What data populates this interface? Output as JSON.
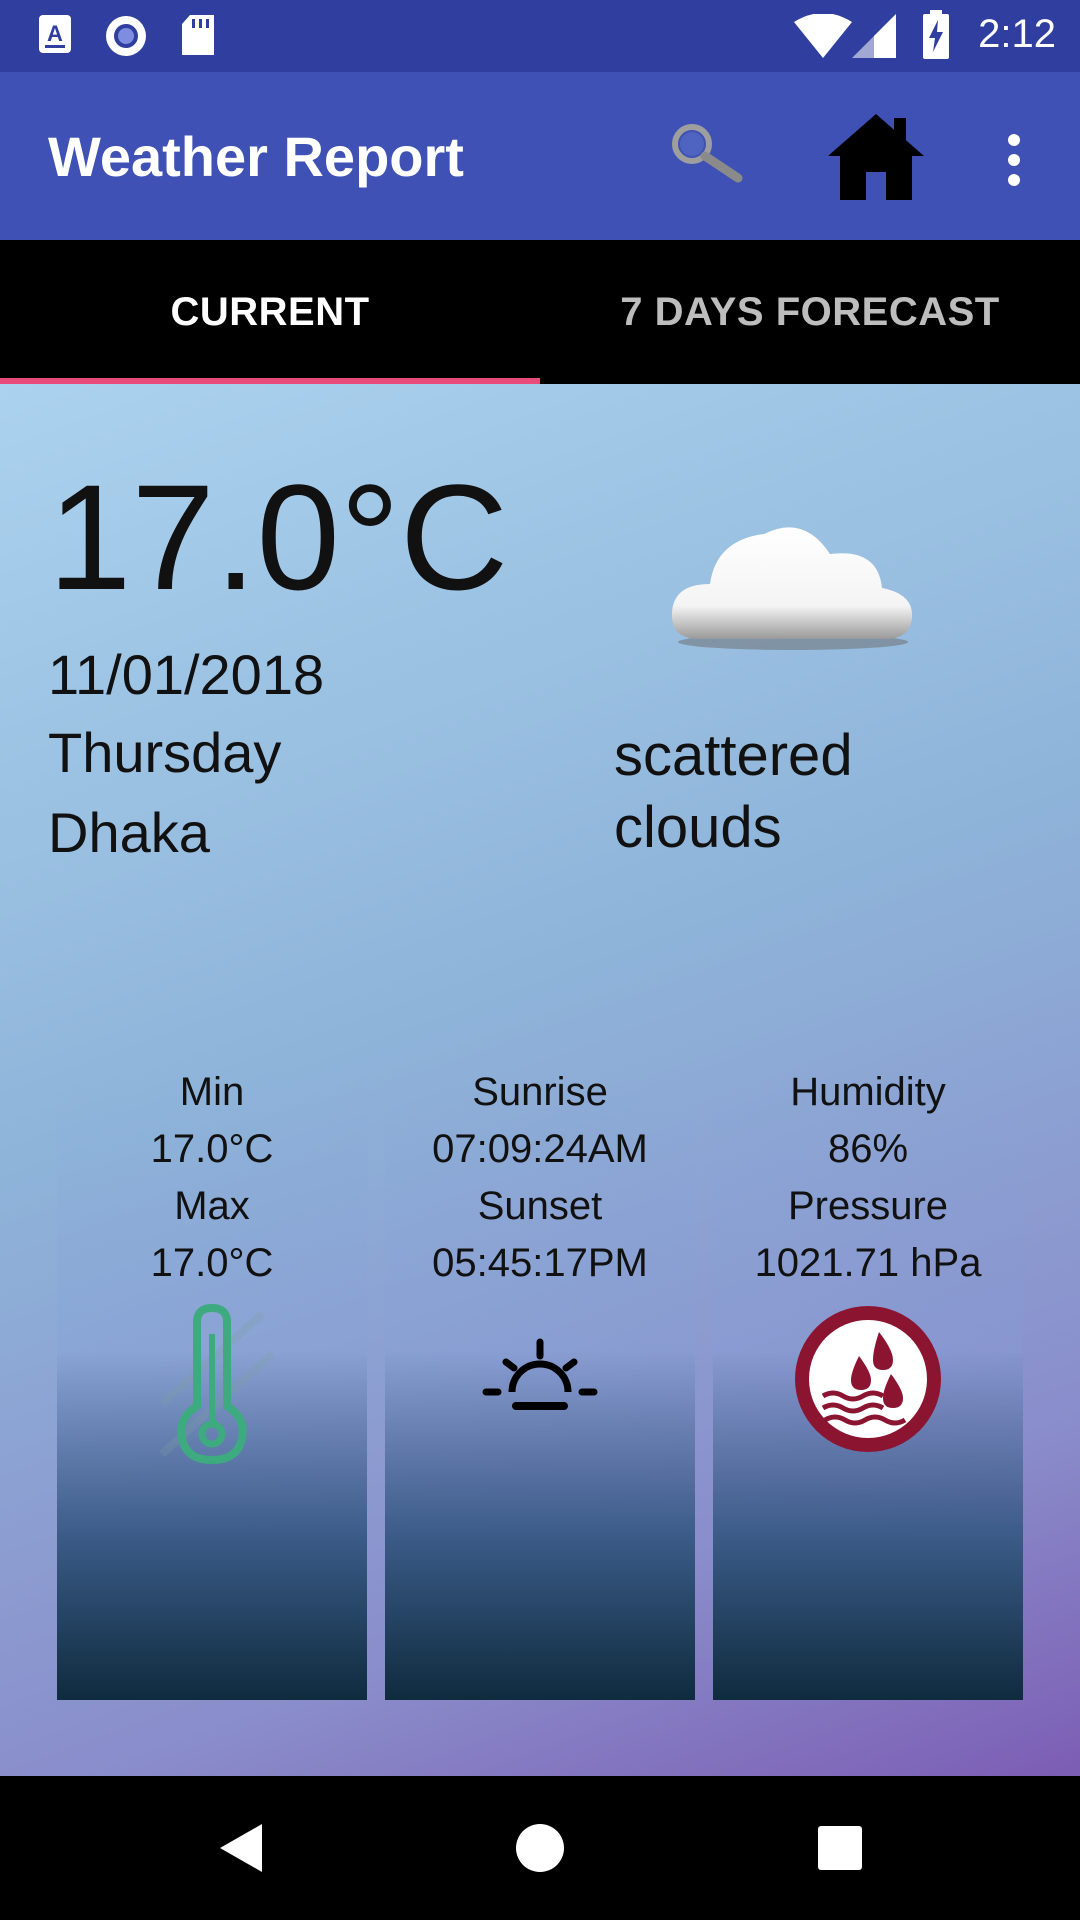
{
  "status_bar": {
    "time": "2:12",
    "icons": [
      "a-text-icon",
      "record-icon",
      "sd-card-icon",
      "wifi-icon",
      "cell-signal-icon",
      "battery-charging-icon"
    ]
  },
  "app_bar": {
    "title": "Weather Report",
    "actions": [
      "search-icon",
      "home-icon",
      "more-vert-icon"
    ]
  },
  "tabs": [
    {
      "label": "CURRENT",
      "active": true
    },
    {
      "label": "7 DAYS FORECAST",
      "active": false
    }
  ],
  "current": {
    "temperature": "17.0°C",
    "date": "11/01/2018",
    "day": "Thursday",
    "city": "Dhaka",
    "description": "scattered clouds",
    "condition_icon": "cloud-icon"
  },
  "cards": {
    "temp": {
      "min_label": "Min",
      "min_value": "17.0°C",
      "max_label": "Max",
      "max_value": "17.0°C",
      "icon": "thermometer-icon"
    },
    "sun": {
      "sunrise_label": "Sunrise",
      "sunrise_value": "07:09:24AM",
      "sunset_label": "Sunset",
      "sunset_value": "05:45:17PM",
      "icon": "sunrise-icon"
    },
    "air": {
      "humidity_label": "Humidity",
      "humidity_value": "86%",
      "pressure_label": "Pressure",
      "pressure_value": "1021.71 hPa",
      "icon": "humidity-icon"
    }
  },
  "colors": {
    "status_bar": "#303F9F",
    "app_bar": "#3F51B5",
    "tab_indicator": "#E94B7A",
    "thermometer": "#3DAA7F",
    "humidity_ring": "#8B1531"
  },
  "nav_bar": [
    "back-icon",
    "home-circle-icon",
    "recents-icon"
  ]
}
